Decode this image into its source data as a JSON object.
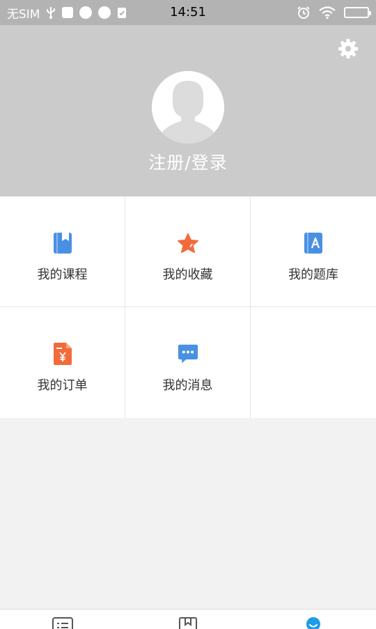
{
  "status_bar": {
    "carrier": "无SIM",
    "time": "14:51",
    "icons_left": [
      "usb-icon",
      "notification-app-icon",
      "basketball-icon",
      "planet-icon",
      "clipboard-check-icon"
    ],
    "icons_right": [
      "alarm-icon",
      "wifi-icon",
      "battery-icon"
    ]
  },
  "header": {
    "settings_icon": "gear-icon",
    "avatar_icon": "default-avatar-icon",
    "login_label": "注册/登录",
    "background_color": "#cbcbcb"
  },
  "menu": {
    "items": [
      {
        "label": "我的课程",
        "icon": "course-book-icon",
        "color": "#4a90e2"
      },
      {
        "label": "我的收藏",
        "icon": "star-icon",
        "color": "#f26b3a"
      },
      {
        "label": "我的题库",
        "icon": "question-bank-book-icon",
        "color": "#4a90e2"
      },
      {
        "label": "我的订单",
        "icon": "order-document-icon",
        "color": "#f26b3a"
      },
      {
        "label": "我的消息",
        "icon": "message-bubble-icon",
        "color": "#4a90e2"
      }
    ]
  },
  "tab_bar": {
    "tabs": [
      {
        "icon": "list-icon",
        "active": false
      },
      {
        "icon": "book-icon",
        "active": false
      },
      {
        "icon": "profile-icon",
        "active": true,
        "color": "#1e9be8"
      }
    ]
  }
}
